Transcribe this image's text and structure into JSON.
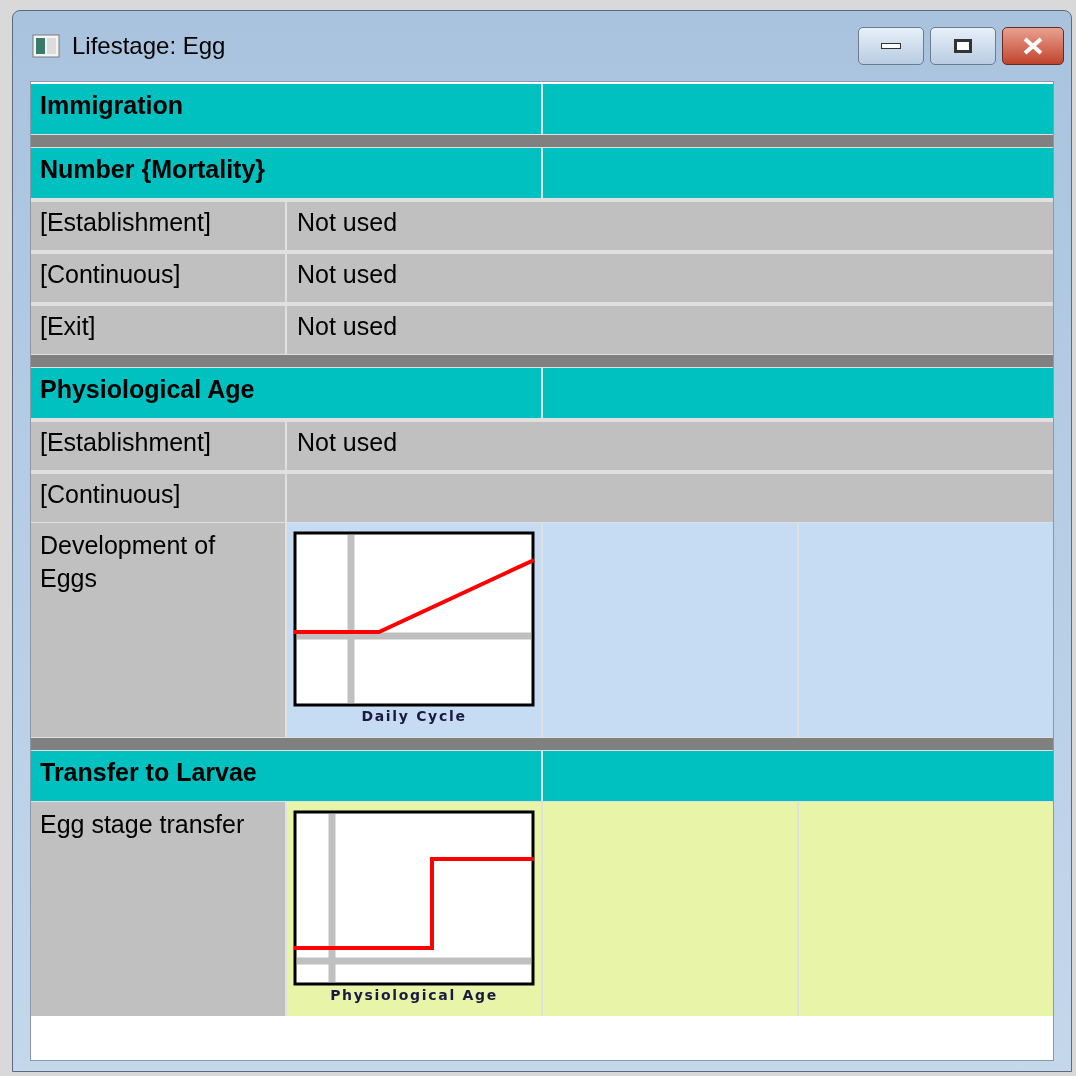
{
  "window": {
    "title": "Lifestage: Egg"
  },
  "sections": [
    {
      "title": "Immigration"
    },
    {
      "title": "Number {Mortality}",
      "rows": [
        {
          "kind": "text",
          "label": "[Establishment]",
          "value": "Not used"
        },
        {
          "kind": "text",
          "label": "[Continuous]",
          "value": "Not used"
        },
        {
          "kind": "text",
          "label": "[Exit]",
          "value": "Not used"
        }
      ]
    },
    {
      "title": "Physiological Age",
      "rows": [
        {
          "kind": "text",
          "label": "[Establishment]",
          "value": "Not used"
        },
        {
          "kind": "text",
          "label": "[Continuous]"
        },
        {
          "kind": "ramp",
          "label": "Development of Eggs",
          "caption": "Daily Cycle",
          "color": "#c6dcf2"
        }
      ]
    },
    {
      "title": "Transfer to Larvae",
      "rows": [
        {
          "kind": "step",
          "label": "Egg stage transfer",
          "caption": "Physiological Age",
          "color": "#e8f4a8"
        }
      ]
    }
  ]
}
